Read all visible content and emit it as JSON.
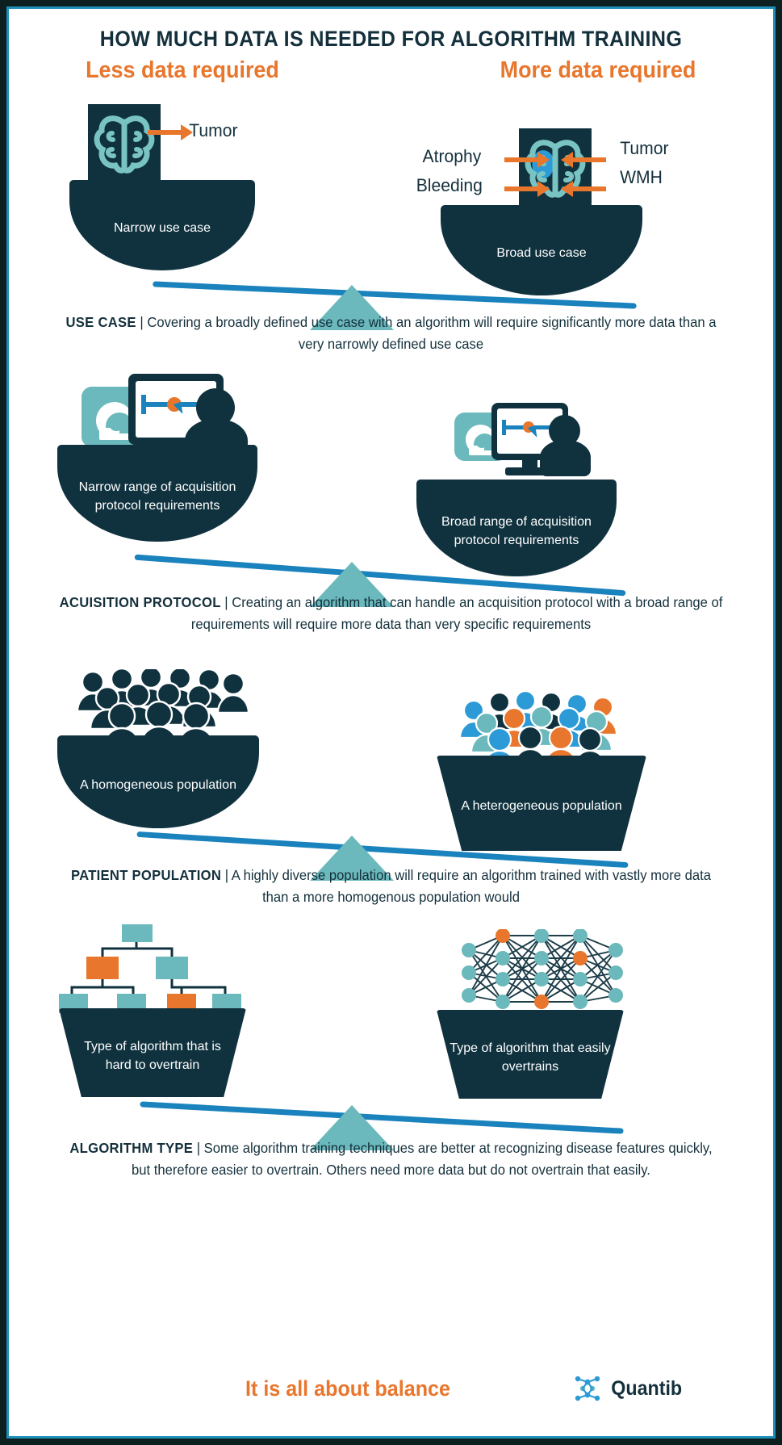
{
  "header": {
    "title": "HOW MUCH DATA IS NEEDED FOR ALGORITHM TRAINING",
    "left_label": "Less data required",
    "right_label": "More data required"
  },
  "colors": {
    "navy": "#10323f",
    "teal": "#6bb9bc",
    "blue": "#1a82bc",
    "orange": "#e8762c",
    "border": "#1d8fb8",
    "background_outer": "#0d1f1f"
  },
  "sections": [
    {
      "key": "use-case",
      "left_bowl": "Narrow use case",
      "right_bowl": "Broad use case",
      "left_annotations": [
        "Tumor"
      ],
      "right_annotations": [
        "Atrophy",
        "Bleeding",
        "Tumor",
        "WMH"
      ],
      "caption_label": "USE CASE",
      "caption_divider": "|",
      "caption_text": "Covering a broadly defined use case with an algorithm will require significantly more data than a very narrowly defined use case"
    },
    {
      "key": "acquisition-protocol",
      "left_bowl": "Narrow range of acquisition protocol requirements",
      "right_bowl": "Broad range of acquisition protocol requirements",
      "caption_label": "ACUISITION PROTOCOL",
      "caption_divider": "|",
      "caption_text": "Creating an algorithm that can handle an acquisition protocol with a broad range of requirements will require more data than very specific requirements"
    },
    {
      "key": "patient-population",
      "left_bowl": "A homogeneous population",
      "right_bowl": "A heterogeneous population",
      "caption_label": "PATIENT POPULATION",
      "caption_divider": "|",
      "caption_text": "A highly diverse population will require an algorithm trained with vastly more data than a more homogenous population would"
    },
    {
      "key": "algorithm-type",
      "left_bowl": "Type of algorithm that is hard to overtrain",
      "right_bowl": "Type of algorithm that easily overtrains",
      "caption_label": "ALGORITHM TYPE",
      "caption_divider": "|",
      "caption_text": "Some algorithm training techniques are better at recognizing disease features quickly, but therefore easier to overtrain. Others need more data but do not overtrain that easily."
    }
  ],
  "footer": {
    "slogan": "It is all about balance",
    "brand": "Quantib"
  }
}
